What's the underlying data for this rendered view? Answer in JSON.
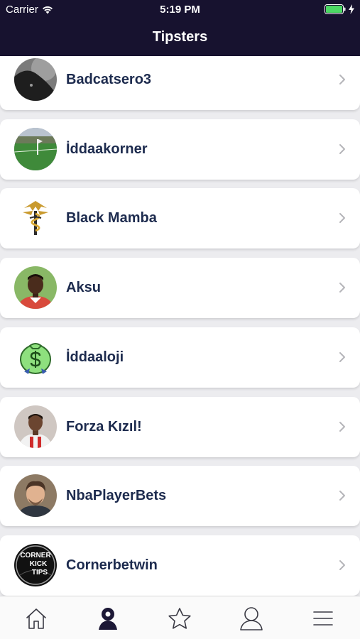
{
  "status_bar": {
    "carrier": "Carrier",
    "time": "5:19 PM"
  },
  "header": {
    "title": "Tipsters"
  },
  "tipsters": [
    {
      "name": "Badcatsero3",
      "icon": "black-cat-avatar"
    },
    {
      "name": "İddaakorner",
      "icon": "football-pitch-avatar"
    },
    {
      "name": "Black Mamba",
      "icon": "mamba-logo-avatar"
    },
    {
      "name": "Aksu",
      "icon": "player-portrait-avatar"
    },
    {
      "name": "İddaaloji",
      "icon": "money-bag-avatar"
    },
    {
      "name": "Forza Kızıl!",
      "icon": "player-portrait-avatar"
    },
    {
      "name": "NbaPlayerBets",
      "icon": "person-portrait-avatar"
    },
    {
      "name": "Cornerbetwin",
      "icon": "corner-kick-tips-avatar",
      "avatar_text": [
        "CORNER",
        "KICK",
        "TIPS"
      ]
    }
  ],
  "tab_bar": {
    "items": [
      "home-icon",
      "tipster-icon",
      "star-icon",
      "profile-icon",
      "menu-icon"
    ],
    "active_index": 1
  },
  "colors": {
    "header_bg": "#17122f",
    "name_text": "#1d2b4e",
    "battery": "#4cd964"
  }
}
